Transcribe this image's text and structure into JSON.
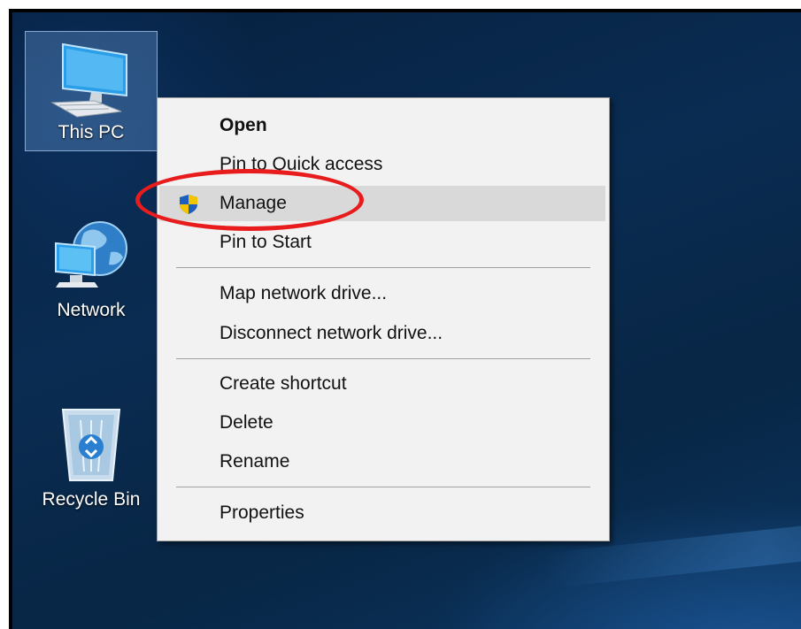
{
  "desktop": {
    "icons": [
      {
        "label": "This PC",
        "icon": "computer-icon",
        "selected": true
      },
      {
        "label": "Network",
        "icon": "network-icon"
      },
      {
        "label": "Recycle Bin",
        "icon": "recycle-bin-icon"
      }
    ]
  },
  "context_menu": {
    "items": [
      {
        "label": "Open",
        "bold": true
      },
      {
        "label": "Pin to Quick access"
      },
      {
        "label": "Manage",
        "icon": "uac-shield-icon",
        "highlighted": true
      },
      {
        "label": "Pin to Start"
      },
      {
        "label": "Map network drive..."
      },
      {
        "label": "Disconnect network drive..."
      },
      {
        "label": "Create shortcut"
      },
      {
        "label": "Delete"
      },
      {
        "label": "Rename"
      },
      {
        "label": "Properties"
      }
    ]
  },
  "annotation": {
    "color": "#e81c1c",
    "target": "Manage"
  },
  "colors": {
    "menu_bg": "#f2f2f2",
    "hover_bg": "#d9d9d9",
    "desktop_bg": "#0a2c52"
  }
}
